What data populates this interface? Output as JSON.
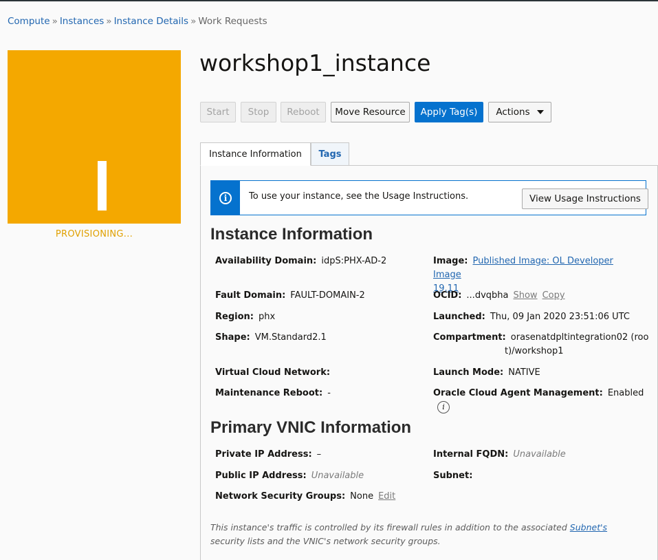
{
  "breadcrumb": [
    {
      "label": "Compute",
      "link": true
    },
    {
      "label": "Instances",
      "link": true
    },
    {
      "label": "Instance Details",
      "link": true
    },
    {
      "label": "Work Requests",
      "link": false
    }
  ],
  "breadcrumb_sep": "»",
  "tile": {
    "letter": "I",
    "status": "PROVISIONING...",
    "color": "#f4a800"
  },
  "title": "workshop1_instance",
  "buttons": {
    "start": "Start",
    "stop": "Stop",
    "reboot": "Reboot",
    "move": "Move Resource",
    "apply_tags": "Apply Tag(s)",
    "actions": "Actions"
  },
  "tabs": {
    "info": "Instance Information",
    "tags": "Tags"
  },
  "notice": {
    "icon": "info-icon",
    "message": "To use your instance, see the Usage Instructions.",
    "button": "View Usage Instructions"
  },
  "instance_info": {
    "heading": "Instance Information",
    "availability_domain": {
      "label": "Availability Domain:",
      "value": "idpS:PHX-AD-2"
    },
    "image": {
      "label": "Image:",
      "value_line1": "Published Image: OL Developer Image",
      "value_line2": "19.11"
    },
    "fault_domain": {
      "label": "Fault Domain:",
      "value": "FAULT-DOMAIN-2"
    },
    "ocid": {
      "label": "OCID:",
      "value": "...dvqbha",
      "show": "Show",
      "copy": "Copy"
    },
    "region": {
      "label": "Region:",
      "value": "phx"
    },
    "launched": {
      "label": "Launched:",
      "value": "Thu, 09 Jan 2020 23:51:06 UTC"
    },
    "shape": {
      "label": "Shape:",
      "value": "VM.Standard2.1"
    },
    "compartment": {
      "label": "Compartment:",
      "value_line1": "orasenatdpltintegration02 (roo",
      "value_line2": "t)/workshop1"
    },
    "vcn": {
      "label": "Virtual Cloud Network:",
      "value": ""
    },
    "launch_mode": {
      "label": "Launch Mode:",
      "value": "NATIVE"
    },
    "maintenance_reboot": {
      "label": "Maintenance Reboot:",
      "value": "-"
    },
    "agent_mgmt": {
      "label": "Oracle Cloud Agent Management:",
      "value": "Enabled",
      "icon": "info-icon"
    }
  },
  "vnic_info": {
    "heading": "Primary VNIC Information",
    "private_ip": {
      "label": "Private IP Address:",
      "value": "–"
    },
    "internal_fqdn": {
      "label": "Internal FQDN:",
      "value": "Unavailable"
    },
    "public_ip": {
      "label": "Public IP Address:",
      "value": "Unavailable"
    },
    "subnet": {
      "label": "Subnet:",
      "value": ""
    },
    "nsg": {
      "label": "Network Security Groups:",
      "value": "None",
      "edit": "Edit"
    }
  },
  "footnote": {
    "before": "This instance's traffic is controlled by its firewall rules in addition to the associated ",
    "link": "Subnet's",
    "after": " security lists and the VNIC's network security groups."
  }
}
